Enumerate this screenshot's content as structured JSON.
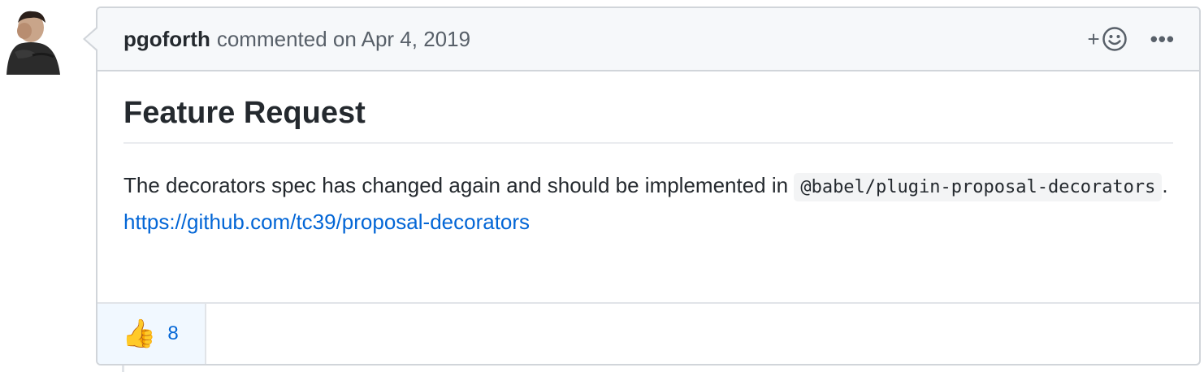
{
  "comment": {
    "author": "pgoforth",
    "meta": "commented on Apr 4, 2019",
    "add_reaction_plus": "+",
    "more_actions": "•••",
    "heading": "Feature Request",
    "body_text_1": "The decorators spec has changed again and should be implemented in ",
    "body_code": "@babel/plugin-proposal-decorators",
    "body_text_2": ".",
    "link": "https://github.com/tc39/proposal-decorators"
  },
  "reactions": [
    {
      "emoji": "👍",
      "icon": "thumbs-up-icon",
      "count": "8"
    }
  ],
  "colors": {
    "link": "#0366d6",
    "header_bg": "#f6f8fa",
    "border": "#d1d5da",
    "reaction_bg": "#f1f8ff"
  }
}
